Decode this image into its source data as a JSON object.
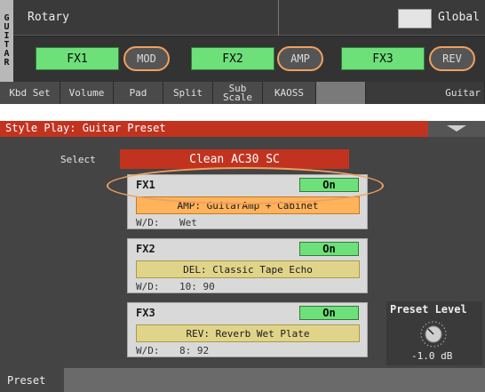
{
  "top": {
    "side_tab_letters": [
      "G",
      "U",
      "I",
      "T",
      "A",
      "R"
    ],
    "track_name": "Rotary",
    "global_label": "Global",
    "fx_buttons": [
      {
        "label": "FX1",
        "control": "MOD"
      },
      {
        "label": "FX2",
        "control": "AMP"
      },
      {
        "label": "FX3",
        "control": "REV"
      }
    ],
    "tabs": [
      {
        "label": "Kbd Set"
      },
      {
        "label": "Volume"
      },
      {
        "label": "Pad"
      },
      {
        "label": "Split"
      },
      {
        "label": "Sub Scale"
      },
      {
        "label": "KAOSS"
      },
      {
        "label": ""
      },
      {
        "label": "Guitar"
      }
    ]
  },
  "bottom": {
    "title": "Style Play: Guitar Preset",
    "select_label": "Select",
    "preset_value": "Clean AC30 SC",
    "fx_panels": [
      {
        "name": "FX1",
        "state": "On",
        "type": "AMP: GuitarAmp + Cabinet",
        "wd_label": "W/D:",
        "wd_value": "Wet"
      },
      {
        "name": "FX2",
        "state": "On",
        "type": "DEL: Classic Tape Echo",
        "wd_label": "W/D:",
        "wd_value": "10: 90"
      },
      {
        "name": "FX3",
        "state": "On",
        "type": "REV: Reverb Wet Plate",
        "wd_label": "W/D:",
        "wd_value": "8: 92"
      }
    ],
    "preset_level": {
      "title": "Preset Level",
      "value": "-1.0 dB"
    },
    "bottom_tab": "Preset"
  },
  "colors": {
    "accent_red": "#c2331f",
    "on_green": "#6ee07a",
    "highlight_orange": "#f0a060"
  }
}
